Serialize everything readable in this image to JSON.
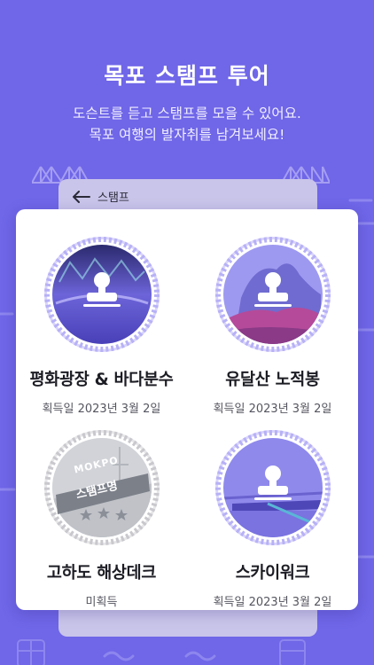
{
  "header": {
    "title": "목포 스탬프 투어",
    "subtitle_line1": "도슨트를 듣고 스탬프를 모을 수 있어요.",
    "subtitle_line2": "목포 여행의 발자취를 남겨보세요!"
  },
  "back_screen": {
    "title": "스탬프",
    "back_icon": "arrow-left-icon"
  },
  "stamps": [
    {
      "name": "평화광장 & 바다분수",
      "status": "획득일 2023년 3월 2일",
      "acquired": true,
      "icon": "stamp-icon"
    },
    {
      "name": "유달산 노적봉",
      "status": "획득일 2023년 3월 2일",
      "acquired": true,
      "icon": "stamp-icon"
    },
    {
      "name": "고하도 해상데크",
      "status": "미획득",
      "acquired": false,
      "badge_top": "MOKPO",
      "badge_ribbon": "스탬프명",
      "icon": "star-icon"
    },
    {
      "name": "스카이워크",
      "status": "획득일 2023년 3월 2일",
      "acquired": true,
      "icon": "stamp-icon"
    }
  ],
  "colors": {
    "background": "#6f66e8",
    "seal_ring": "#b7b1f6",
    "card": "#ffffff"
  }
}
